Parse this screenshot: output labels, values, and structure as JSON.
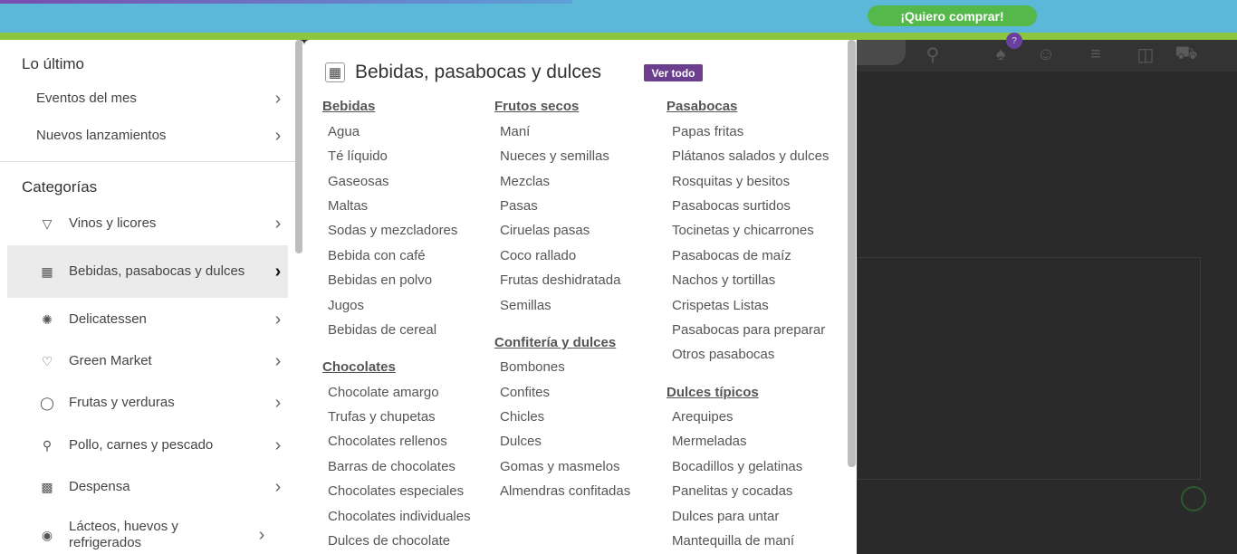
{
  "topbar": {
    "buy_label": "¡Quiero comprar!"
  },
  "header": {
    "cart_badge": "?"
  },
  "left_menu": {
    "recent_title": "Lo último",
    "recent_items": [
      {
        "label": "Eventos del mes"
      },
      {
        "label": "Nuevos lanzamientos"
      }
    ],
    "categories_title": "Categorías",
    "categories": [
      {
        "label": "Vinos y licores",
        "icon": "wine-glass-icon"
      },
      {
        "label": "Bebidas, pasabocas y dulces",
        "icon": "snacks-icon"
      },
      {
        "label": "Delicatessen",
        "icon": "cookie-icon"
      },
      {
        "label": "Green Market",
        "icon": "heart-icon"
      },
      {
        "label": "Frutas y verduras",
        "icon": "apple-icon"
      },
      {
        "label": "Pollo, carnes y pescado",
        "icon": "drumstick-icon"
      },
      {
        "label": "Despensa",
        "icon": "pantry-icon"
      },
      {
        "label": "Lácteos, huevos y refrigerados",
        "icon": "egg-icon"
      }
    ],
    "active_category": "Bebidas, pasabocas y dulces"
  },
  "submenu": {
    "title": "Bebidas, pasabocas y dulces",
    "see_all": "Ver todo",
    "columns": [
      [
        {
          "heading": "Bebidas",
          "items": [
            "Agua",
            "Té líquido",
            "Gaseosas",
            "Maltas",
            "Sodas y mezcladores",
            "Bebida con café",
            "Bebidas en polvo",
            "Jugos",
            "Bebidas de cereal"
          ]
        },
        {
          "heading": "Chocolates",
          "items": [
            "Chocolate amargo",
            "Trufas y chupetas",
            "Chocolates rellenos",
            "Barras de chocolates",
            "Chocolates especiales",
            "Chocolates individuales",
            "Dulces de chocolate"
          ]
        }
      ],
      [
        {
          "heading": "Frutos secos",
          "items": [
            "Maní",
            "Nueces y semillas",
            "Mezclas",
            "Pasas",
            "Ciruelas pasas",
            "Coco rallado",
            "Frutas deshidratada",
            "Semillas"
          ]
        },
        {
          "heading": "Confitería y dulces",
          "items": [
            "Bombones",
            "Confites",
            "Chicles",
            "Dulces",
            "Gomas y masmelos",
            "Almendras confitadas"
          ]
        }
      ],
      [
        {
          "heading": "Pasabocas",
          "items": [
            "Papas fritas",
            "Plátanos salados y dulces",
            "Rosquitas y besitos",
            "Pasabocas surtidos",
            "Tocinetas y chicarrones",
            "Pasabocas de maíz",
            "Nachos y tortillas",
            "Crispetas Listas",
            "Pasabocas para preparar",
            "Otros pasabocas"
          ]
        },
        {
          "heading": "Dulces típicos",
          "items": [
            "Arequipes",
            "Mermeladas",
            "Bocadillos y gelatinas",
            "Panelitas y cocadas",
            "Dulces para untar",
            "Mantequilla de maní"
          ]
        }
      ]
    ]
  }
}
